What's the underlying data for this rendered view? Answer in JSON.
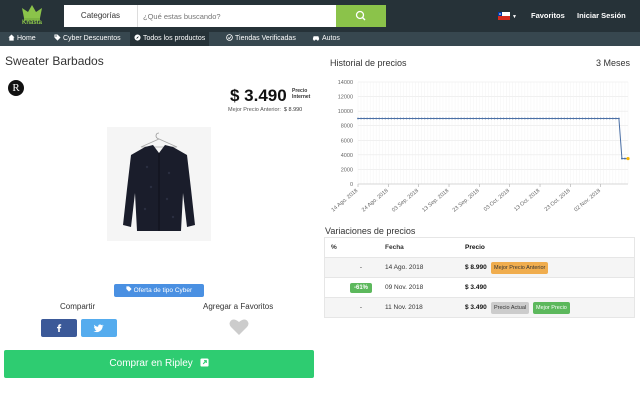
{
  "brand": {
    "logo_word": "Knasta"
  },
  "header": {
    "categories_label": "Categorías",
    "search_placeholder": "¿Qué estas buscando?",
    "favorites_label": "Favoritos",
    "login_label": "Iniciar Sesión"
  },
  "nav": {
    "tabs": [
      {
        "label": "Home",
        "icon": "home-icon"
      },
      {
        "label": "Cyber Descuentos",
        "icon": "tag-icon"
      },
      {
        "label": "Todos los productos",
        "icon": "compass-icon",
        "active": true
      },
      {
        "label": "Tiendas Verificadas",
        "icon": "check-circle-icon"
      },
      {
        "label": "Autos",
        "icon": "car-icon"
      }
    ]
  },
  "product": {
    "title": "Sweater Barbados",
    "store_initial": "R",
    "price": "$ 3.490",
    "price_note_line1": "Precio",
    "price_note_line2": "Internet",
    "previous_label": "Mejor Precio Anterior:",
    "previous_value": "$ 8.990",
    "cyber_badge": "Oferta de tipo Cyber",
    "share_label": "Compartir",
    "favorites_label": "Agregar a Favoritos",
    "buy_label": "Comprar en Ripley"
  },
  "history": {
    "title": "Historial de precios",
    "range": "3 Meses"
  },
  "chart_data": {
    "type": "line",
    "y_ticks": [
      0,
      2000,
      4000,
      6000,
      8000,
      10000,
      12000,
      14000
    ],
    "ylim": [
      0,
      14000
    ],
    "x_ticks": [
      "14 Ago. 2018",
      "24 Ago. 2018",
      "03 Sep. 2018",
      "13 Sep. 2018",
      "23 Sep. 2018",
      "03 Oct. 2018",
      "13 Oct. 2018",
      "23 Oct. 2018",
      "02 Nov. 2018"
    ],
    "x_start": "2018-08-14",
    "x_end": "2018-11-11",
    "series": [
      {
        "color": "#4a6fa5",
        "points": [
          [
            "2018-08-14",
            8990
          ],
          [
            "2018-11-08",
            8990
          ],
          [
            "2018-11-09",
            3490
          ],
          [
            "2018-11-11",
            3490
          ]
        ]
      }
    ],
    "grid": true,
    "legend": "none"
  },
  "variations": {
    "title": "Variaciones de precios",
    "headers": {
      "pct": "%",
      "date": "Fecha",
      "price": "Precio"
    },
    "rows": [
      {
        "pct": "-",
        "date": "14 Ago. 2018",
        "price": "$ 8.990",
        "tags": [
          "Mejor Precio Anterior"
        ]
      },
      {
        "pct": "-61%",
        "date": "09 Nov. 2018",
        "price": "$ 3.490",
        "tags": []
      },
      {
        "pct": "-",
        "date": "11 Nov. 2018",
        "price": "$ 3.490",
        "tags": [
          "Precio Actual",
          "Mejor Precio"
        ]
      }
    ]
  },
  "colors": {
    "header_bg": "#263238",
    "accent_green": "#8bc34a",
    "buy_green": "#2ecc71",
    "line": "#4a6fa5"
  }
}
